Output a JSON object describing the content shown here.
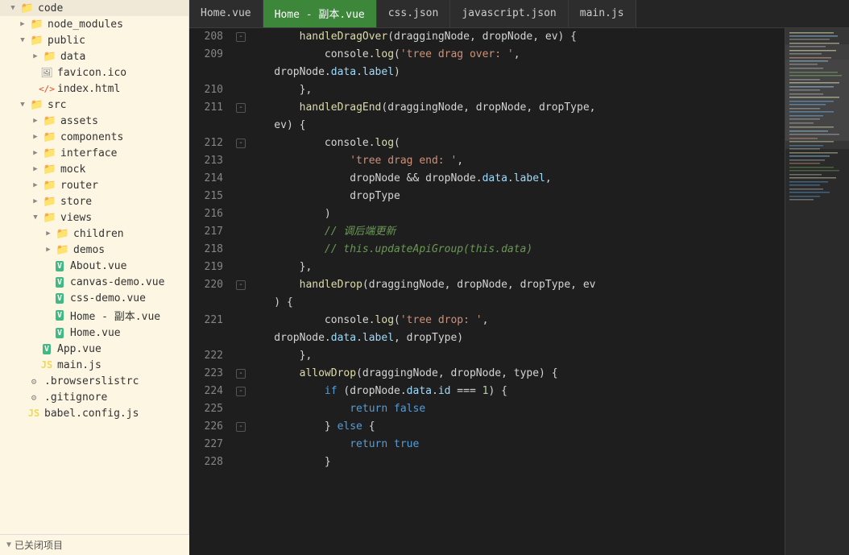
{
  "sidebar": {
    "items": [
      {
        "id": "code",
        "label": "code",
        "type": "folder",
        "indent": "indent-1",
        "open": true
      },
      {
        "id": "node_modules",
        "label": "node_modules",
        "type": "folder",
        "indent": "indent-2",
        "open": false
      },
      {
        "id": "public",
        "label": "public",
        "type": "folder",
        "indent": "indent-2",
        "open": true
      },
      {
        "id": "data",
        "label": "data",
        "type": "folder",
        "indent": "indent-3",
        "open": false
      },
      {
        "id": "favicon",
        "label": "favicon.ico",
        "type": "ico",
        "indent": "indent-3"
      },
      {
        "id": "index",
        "label": "index.html",
        "type": "html",
        "indent": "indent-3"
      },
      {
        "id": "src",
        "label": "src",
        "type": "folder",
        "indent": "indent-2",
        "open": true
      },
      {
        "id": "assets",
        "label": "assets",
        "type": "folder",
        "indent": "indent-3",
        "open": false
      },
      {
        "id": "components",
        "label": "components",
        "type": "folder",
        "indent": "indent-3",
        "open": false
      },
      {
        "id": "interface",
        "label": "interface",
        "type": "folder",
        "indent": "indent-3",
        "open": false
      },
      {
        "id": "mock",
        "label": "mock",
        "type": "folder",
        "indent": "indent-3",
        "open": false
      },
      {
        "id": "router",
        "label": "router",
        "type": "folder",
        "indent": "indent-3",
        "open": false
      },
      {
        "id": "store",
        "label": "store",
        "type": "folder",
        "indent": "indent-3",
        "open": false
      },
      {
        "id": "views",
        "label": "views",
        "type": "folder",
        "indent": "indent-3",
        "open": true
      },
      {
        "id": "children",
        "label": "children",
        "type": "folder",
        "indent": "indent-4",
        "open": false
      },
      {
        "id": "demos",
        "label": "demos",
        "type": "folder",
        "indent": "indent-4",
        "open": false
      },
      {
        "id": "About.vue",
        "label": "About.vue",
        "type": "vue",
        "indent": "indent-4"
      },
      {
        "id": "canvas-demo.vue",
        "label": "canvas-demo.vue",
        "type": "vue",
        "indent": "indent-4"
      },
      {
        "id": "css-demo.vue",
        "label": "css-demo.vue",
        "type": "vue",
        "indent": "indent-4"
      },
      {
        "id": "Home-copy.vue",
        "label": "Home - 副本.vue",
        "type": "vue",
        "indent": "indent-4"
      },
      {
        "id": "Home.vue",
        "label": "Home.vue",
        "type": "vue",
        "indent": "indent-4"
      },
      {
        "id": "App.vue",
        "label": "App.vue",
        "type": "vue",
        "indent": "indent-3"
      },
      {
        "id": "main.js",
        "label": "main.js",
        "type": "js",
        "indent": "indent-3"
      },
      {
        "id": "browserslistrc",
        "label": ".browserslistrc",
        "type": "rc",
        "indent": "indent-2"
      },
      {
        "id": "gitignore",
        "label": ".gitignore",
        "type": "rc",
        "indent": "indent-2"
      },
      {
        "id": "babel.config.js",
        "label": "babel.config.js",
        "type": "js",
        "indent": "indent-2"
      }
    ],
    "bottom_label": "已关闭项目"
  },
  "tabs": [
    {
      "id": "home-vue",
      "label": "Home.vue",
      "active": false
    },
    {
      "id": "home-copy-vue",
      "label": "Home - 副本.vue",
      "active": true
    },
    {
      "id": "css-json",
      "label": "css.json",
      "active": false
    },
    {
      "id": "javascript-json",
      "label": "javascript.json",
      "active": false
    },
    {
      "id": "main-js",
      "label": "main.js",
      "active": false
    }
  ],
  "code_lines": [
    {
      "num": 208,
      "fold": true,
      "content": "        handleDragOver(draggingNode, dropNode, ev) {"
    },
    {
      "num": 209,
      "fold": false,
      "content": "            console.log('tree drag over: ',"
    },
    {
      "num": null,
      "fold": false,
      "content": "    dropNode.data.label)"
    },
    {
      "num": 210,
      "fold": false,
      "content": "        },"
    },
    {
      "num": 211,
      "fold": true,
      "content": "        handleDragEnd(draggingNode, dropNode, dropType,"
    },
    {
      "num": null,
      "fold": false,
      "content": "    ev) {"
    },
    {
      "num": 212,
      "fold": true,
      "content": "            console.log("
    },
    {
      "num": 213,
      "fold": false,
      "content": "                'tree drag end: ',"
    },
    {
      "num": 214,
      "fold": false,
      "content": "                dropNode && dropNode.data.label,"
    },
    {
      "num": 215,
      "fold": false,
      "content": "                dropType"
    },
    {
      "num": 216,
      "fold": false,
      "content": "            )"
    },
    {
      "num": 217,
      "fold": false,
      "content": "            // 调后端更新"
    },
    {
      "num": 218,
      "fold": false,
      "content": "            // this.updateApiGroup(this.data)"
    },
    {
      "num": 219,
      "fold": false,
      "content": "        },"
    },
    {
      "num": 220,
      "fold": true,
      "content": "        handleDrop(draggingNode, dropNode, dropType, ev"
    },
    {
      "num": null,
      "fold": false,
      "content": "    ) {"
    },
    {
      "num": 221,
      "fold": false,
      "content": "            console.log('tree drop: ',"
    },
    {
      "num": null,
      "fold": false,
      "content": "    dropNode.data.label, dropType)"
    },
    {
      "num": 222,
      "fold": false,
      "content": "        },"
    },
    {
      "num": 223,
      "fold": true,
      "content": "        allowDrop(draggingNode, dropNode, type) {"
    },
    {
      "num": 224,
      "fold": true,
      "content": "            if (dropNode.data.id === 1) {"
    },
    {
      "num": 225,
      "fold": false,
      "content": "                return false"
    },
    {
      "num": 226,
      "fold": true,
      "content": "            } else {"
    },
    {
      "num": 227,
      "fold": false,
      "content": "                return true"
    },
    {
      "num": 228,
      "fold": false,
      "content": "            }"
    }
  ]
}
